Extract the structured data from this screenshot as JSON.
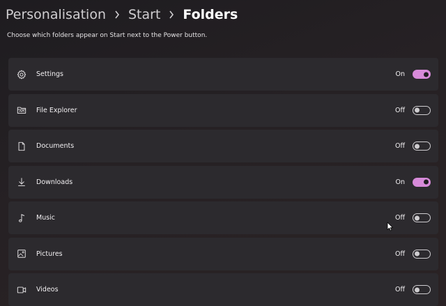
{
  "breadcrumb": {
    "items": [
      "Personalisation",
      "Start",
      "Folders"
    ]
  },
  "subtitle": "Choose which folders appear on Start next to the Power button.",
  "colors": {
    "toggle_on": "#d78ad9",
    "row_background": "#2c2a2e",
    "page_background": "#221f23"
  },
  "folders": [
    {
      "label": "Settings",
      "icon": "gear-icon",
      "state": "On",
      "enabled": true
    },
    {
      "label": "File Explorer",
      "icon": "folder-icon",
      "state": "Off",
      "enabled": false
    },
    {
      "label": "Documents",
      "icon": "document-icon",
      "state": "Off",
      "enabled": false
    },
    {
      "label": "Downloads",
      "icon": "download-icon",
      "state": "On",
      "enabled": true
    },
    {
      "label": "Music",
      "icon": "music-note-icon",
      "state": "Off",
      "enabled": false
    },
    {
      "label": "Pictures",
      "icon": "picture-icon",
      "state": "Off",
      "enabled": false
    },
    {
      "label": "Videos",
      "icon": "video-icon",
      "state": "Off",
      "enabled": false
    }
  ]
}
